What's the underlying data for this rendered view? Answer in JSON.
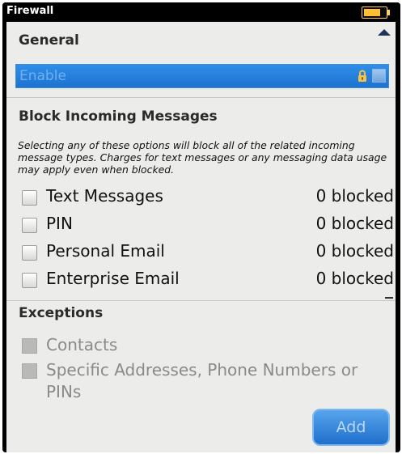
{
  "window": {
    "title": "Firewall"
  },
  "general": {
    "header": "General",
    "enable_label": "Enable"
  },
  "block": {
    "header": "Block Incoming Messages",
    "description": "Selecting any of these options will block all of the related incoming message types. Charges for text messages or any messaging data usage may apply even when blocked.",
    "options": [
      {
        "label": "Text Messages",
        "count": "0 blocked",
        "checked": false
      },
      {
        "label": "PIN",
        "count": "0 blocked",
        "checked": false
      },
      {
        "label": "Personal Email",
        "count": "0 blocked",
        "checked": false
      },
      {
        "label": "Enterprise Email",
        "count": "0 blocked",
        "checked": false
      }
    ]
  },
  "exceptions": {
    "header": "Exceptions",
    "items": [
      {
        "label": "Contacts"
      },
      {
        "label": "Specific Addresses, Phone Numbers or PINs"
      }
    ],
    "add_label": "Add"
  },
  "colors": {
    "accent": "#2f8fe8",
    "titlebar": "#000000",
    "background": "#ececea"
  },
  "icons": [
    "battery-icon",
    "scroll-up-icon",
    "lock-icon",
    "checkbox-icon"
  ]
}
